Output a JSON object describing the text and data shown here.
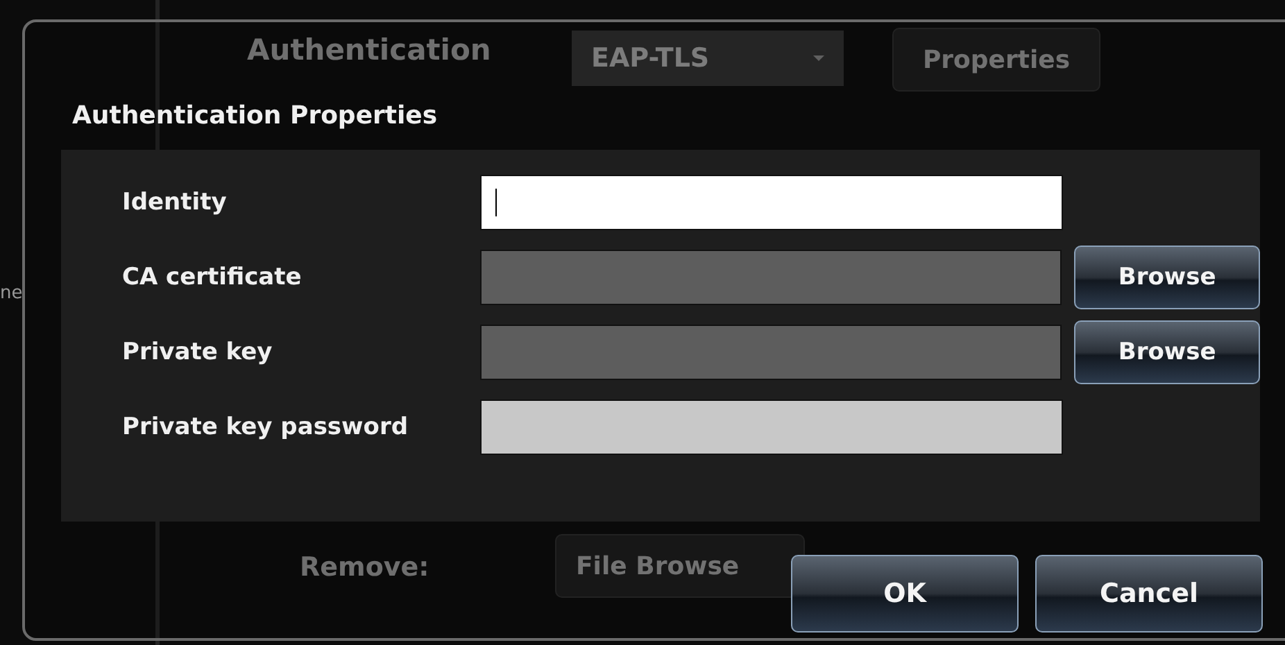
{
  "background_window": {
    "side_text": "ne",
    "authentication_label": "Authentication",
    "method_dropdown": "EAP-TLS",
    "properties_button": "Properties",
    "remove_label": "Remove:",
    "file_browse_button": "File Browse"
  },
  "dialog": {
    "title": "Authentication Properties",
    "fields": [
      {
        "label": "Identity",
        "kind": "text",
        "focused": true
      },
      {
        "label": "CA certificate",
        "kind": "file",
        "focused": false,
        "button": "Browse"
      },
      {
        "label": "Private key",
        "kind": "file",
        "focused": false,
        "button": "Browse"
      },
      {
        "label": "Private key password",
        "kind": "password",
        "focused": false
      }
    ],
    "buttons": [
      "OK",
      "Cancel"
    ]
  }
}
